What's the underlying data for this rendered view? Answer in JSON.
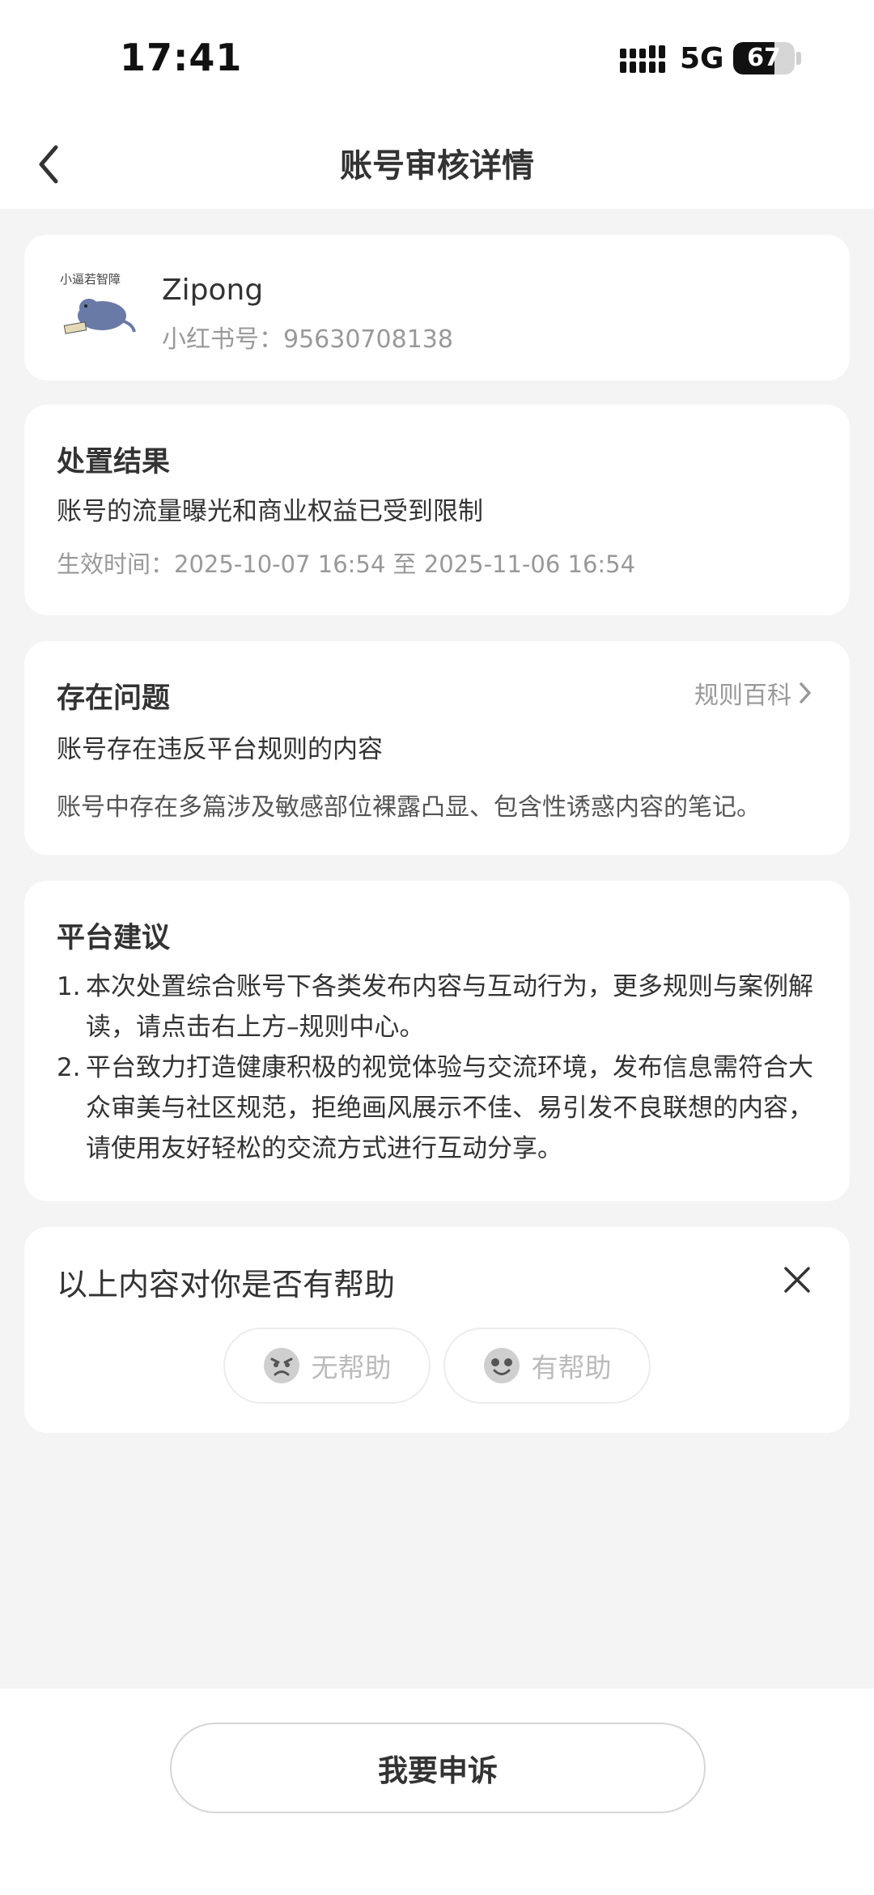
{
  "status_bar": {
    "time": "17:41",
    "network": "5G",
    "battery": 67,
    "battery_label": "67"
  },
  "nav": {
    "title": "账号审核详情"
  },
  "profile": {
    "name": "Zipong",
    "id_label": "小红书号：95630708138",
    "avatar_caption": "小逼若智障"
  },
  "result": {
    "title": "处置结果",
    "text": "账号的流量曝光和商业权益已受到限制",
    "effective": "生效时间：2025-10-07 16:54 至 2025-11-06 16:54"
  },
  "issue": {
    "title": "存在问题",
    "link": "规则百科",
    "summary": "账号存在违反平台规则的内容",
    "detail": "账号中存在多篇涉及敏感部位裸露凸显、包含性诱惑内容的笔记。"
  },
  "advice": {
    "title": "平台建议",
    "items": [
      {
        "num": "1.",
        "text": "本次处置综合账号下各类发布内容与互动行为，更多规则与案例解读，请点击右上方–规则中心。"
      },
      {
        "num": "2.",
        "text": "平台致力打造健康积极的视觉体验与交流环境，发布信息需符合大众审美与社区规范，拒绝画风展示不佳、易引发不良联想的内容，请使用友好轻松的交流方式进行互动分享。"
      }
    ]
  },
  "feedback": {
    "title": "以上内容对你是否有帮助",
    "no_help": "无帮助",
    "helpful": "有帮助"
  },
  "bottom": {
    "appeal": "我要申诉"
  },
  "icons": {
    "back": "chevron-left-icon",
    "close": "close-icon",
    "chevron": "chevron-right-icon",
    "sad_face": "sad-face-icon",
    "happy_face": "happy-face-icon",
    "signal": "signal-icon",
    "battery": "battery-icon"
  },
  "colors": {
    "background": "#f4f4f5",
    "card": "#ffffff",
    "text": "#333333",
    "muted": "#999999"
  }
}
